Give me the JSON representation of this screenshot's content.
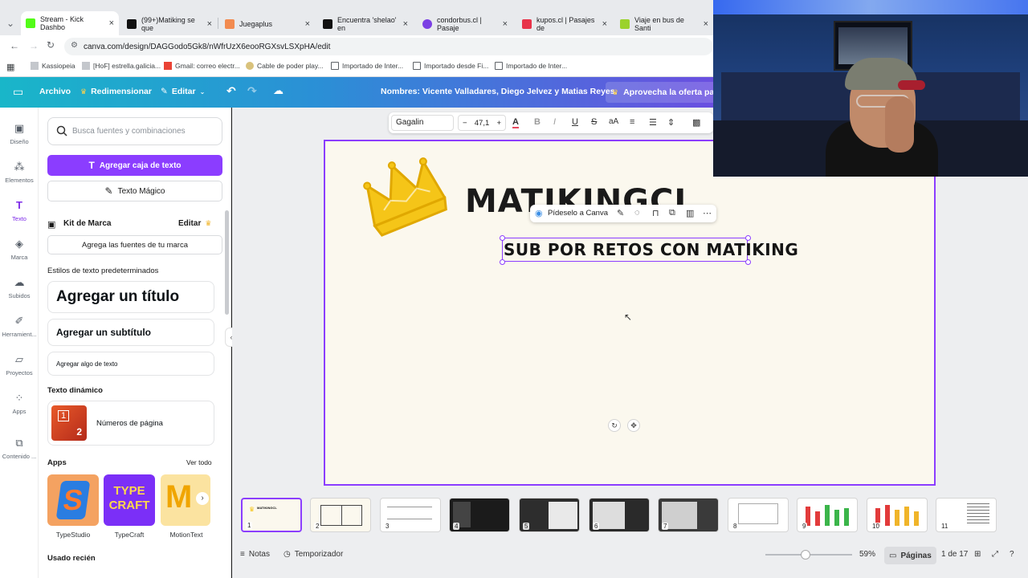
{
  "browser": {
    "tabs": [
      {
        "label": "Stream - Kick Dashbo",
        "color": "#53fc18"
      },
      {
        "label": "(99+)Matiking se que",
        "color": "#111111"
      },
      {
        "label": "Juegaplus",
        "color": "#f28b50"
      },
      {
        "label": "Encuentra 'shelao' en",
        "color": "#111111"
      },
      {
        "label": "condorbus.cl | Pasaje",
        "color": "#7b3fe4"
      },
      {
        "label": "kupos.cl | Pasajes de",
        "color": "#e8334a"
      },
      {
        "label": "Viaje en bus de Santi",
        "color": "#9bd22c"
      }
    ],
    "url": "canva.com/design/DAGGodo5Gk8/nWfrUzX6eooRGXsvLSXpHA/edit",
    "bookmarks": [
      "Kassiopeia",
      "[HoF] estrella.galicia...",
      "Gmail: correo electr...",
      "Cable de poder play...",
      "Importado de Inter...",
      "Importado desde Fi...",
      "Importado de Inter..."
    ]
  },
  "canva_bar": {
    "archivo": "Archivo",
    "redimensionar": "Redimensionar",
    "editar": "Editar",
    "names": "Nombres: Vicente Valladares, Diego Jelvez y Matias Reyes.",
    "promo": "Aprovecha la oferta para"
  },
  "rail": [
    {
      "label": "Diseño",
      "icon": "layout-icon"
    },
    {
      "label": "Elementos",
      "icon": "elements-icon"
    },
    {
      "label": "Texto",
      "icon": "text-icon"
    },
    {
      "label": "Marca",
      "icon": "brand-icon"
    },
    {
      "label": "Subidos",
      "icon": "upload-icon"
    },
    {
      "label": "Herramient...",
      "icon": "draw-icon"
    },
    {
      "label": "Proyectos",
      "icon": "folder-icon"
    },
    {
      "label": "Apps",
      "icon": "apps-icon"
    },
    {
      "label": "Contenido ...",
      "icon": "content-icon"
    }
  ],
  "panel": {
    "search_placeholder": "Busca fuentes y combinaciones",
    "add_textbox": "Agregar caja de texto",
    "magic_text": "Texto Mágico",
    "brand_kit": "Kit de Marca",
    "brand_edit": "Editar",
    "brand_fonts": "Agrega las fuentes de tu marca",
    "default_styles": "Estilos de texto predeterminados",
    "add_title": "Agregar un título",
    "add_subtitle": "Agregar un subtítulo",
    "add_body": "Agregar algo de texto",
    "dynamic_text": "Texto dinámico",
    "page_numbers": "Números de página",
    "apps_heading": "Apps",
    "see_all": "Ver todo",
    "apps": [
      "TypeStudio",
      "TypeCraft",
      "MotionText"
    ],
    "recent": "Usado recién"
  },
  "toolbar": {
    "font": "Gagalin",
    "size": "47,1"
  },
  "canvas": {
    "title": "MATIKINGCL",
    "selected_text": "SUB POR RETOS CON MATIKING",
    "context_label": "Pídeselo a Canva"
  },
  "footer": {
    "notes": "Notas",
    "timer": "Temporizador",
    "zoom": "59%",
    "pages_label": "Páginas",
    "page_count": "1 de 17"
  },
  "thumbnails": [
    "1",
    "2",
    "3",
    "4",
    "5",
    "6",
    "7",
    "8",
    "9",
    "10",
    "11"
  ],
  "colors": {
    "accent": "#8b3dff",
    "crown": "#f5c518"
  }
}
